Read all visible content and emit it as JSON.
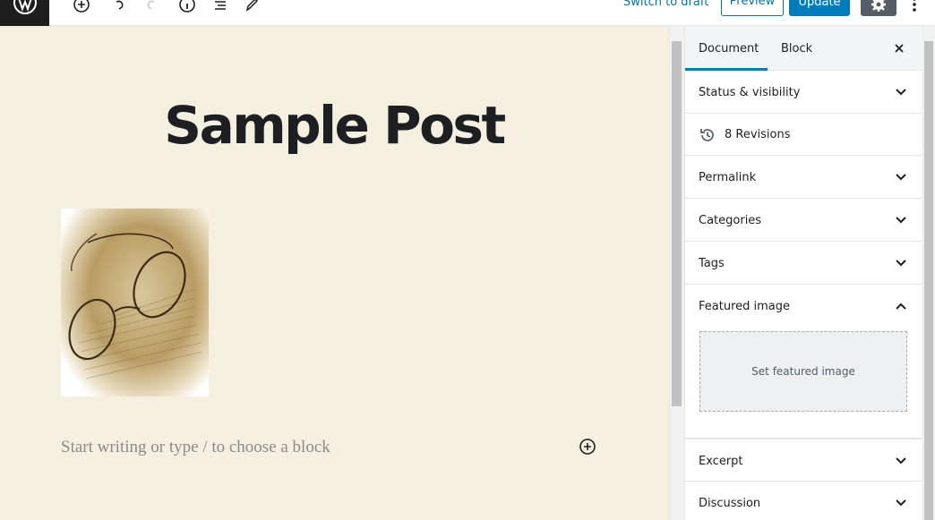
{
  "toolbar": {
    "switch_to_draft": "Switch to draft",
    "preview": "Preview",
    "update": "Update",
    "icons": [
      "wordpress-logo",
      "add-block-icon",
      "undo-icon",
      "redo-icon",
      "info-icon",
      "outline-icon",
      "edit-icon",
      "gear-icon",
      "more-vertical-icon"
    ]
  },
  "editor": {
    "title": "Sample Post",
    "placeholder": "Start writing or type / to choose a block"
  },
  "sidebar": {
    "tabs": [
      {
        "label": "Document",
        "active": true
      },
      {
        "label": "Block",
        "active": false
      }
    ],
    "panels": [
      {
        "label": "Status & visibility",
        "expanded": false
      },
      {
        "label": "8 Revisions"
      },
      {
        "label": "Permalink",
        "expanded": false
      },
      {
        "label": "Categories",
        "expanded": false
      },
      {
        "label": "Tags",
        "expanded": false
      },
      {
        "label": "Featured image",
        "expanded": true
      },
      {
        "label": "Excerpt",
        "expanded": false
      },
      {
        "label": "Discussion",
        "expanded": false
      }
    ],
    "featured_image_button": "Set featured image"
  },
  "colors": {
    "accent": "#007cba",
    "canvas_bg": "#f5efe0",
    "dark": "#1e1e1e"
  }
}
